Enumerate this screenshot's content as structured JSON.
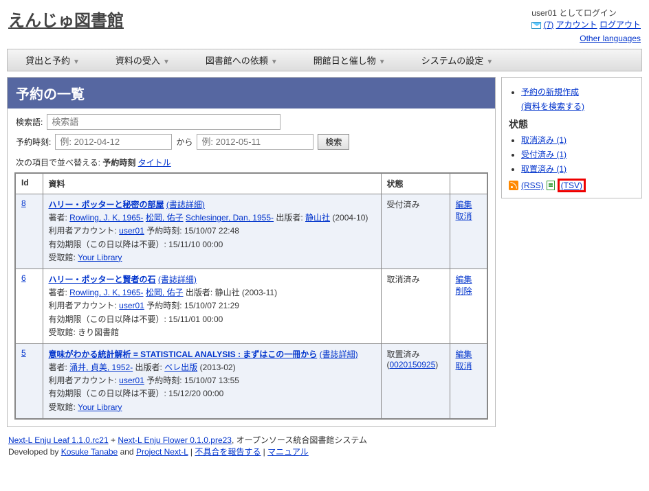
{
  "brand": "えんじゅ図書館",
  "account": {
    "logged_in_as": "user01 としてログイン",
    "messages": "(7)",
    "account_link": "アカウント",
    "logout": "ログアウト",
    "other_langs": "Other languages"
  },
  "nav": {
    "items": [
      "貸出と予約",
      "資料の受入",
      "図書館への依頼",
      "開館日と催し物",
      "システムの設定"
    ]
  },
  "page": {
    "title": "予約の一覧",
    "search_label": "検索語:",
    "search_placeholder": "検索語",
    "period_label": "予約時刻:",
    "from_placeholder": "例: 2012-04-12",
    "to_label": "から",
    "to_placeholder": "例: 2012-05-11",
    "search_btn": "検索",
    "sort_prefix": "次の項目で並べ替える: ",
    "sort_active": "予約時刻",
    "sort_link": "タイトル"
  },
  "table": {
    "headers": {
      "id": "Id",
      "material": "資料",
      "status": "状態",
      "actions": ""
    },
    "rows": [
      {
        "id": "8",
        "title": "ハリー・ポッターと秘密の部屋",
        "detail": "(書誌詳細)",
        "authors_label": "著者: ",
        "authors": [
          "Rowling, J. K, 1965-",
          "松岡, 佑子",
          "Schlesinger, Dan, 1955-"
        ],
        "publisher_label": " 出版者: ",
        "publisher": "静山社",
        "pubdate": " (2004-10)",
        "user_label": "利用者アカウント: ",
        "user": "user01",
        "reserve_label": " 予約時刻: ",
        "reserve_time": "15/10/07 22:48",
        "expire_label": "有効期限（この日以降は不要）: ",
        "expire": "15/11/10 00:00",
        "pickup_label": "受取館: ",
        "pickup": "Your Library",
        "status": "受付済み",
        "actions": [
          "編集",
          "取消"
        ]
      },
      {
        "id": "6",
        "title": "ハリー・ポッターと賢者の石",
        "detail": "(書誌詳細)",
        "authors_label": "著者: ",
        "authors": [
          "Rowling, J. K, 1965-",
          "松岡, 佑子"
        ],
        "publisher_label": " 出版者: ",
        "publisher_plain": "静山社 (2003-11)",
        "user_label": "利用者アカウント: ",
        "user": "user01",
        "reserve_label": " 予約時刻: ",
        "reserve_time": "15/10/07 21:29",
        "expire_label": "有効期限（この日以降は不要）: ",
        "expire": "15/11/01 00:00",
        "pickup_label": "受取館: ",
        "pickup_plain": "きり図書館",
        "status": "取消済み",
        "actions": [
          "編集",
          "削除"
        ]
      },
      {
        "id": "5",
        "title": "意味がわかる統計解析 = STATISTICAL ANALYSIS : まずはこの一冊から",
        "detail": "(書誌詳細)",
        "authors_label": "著者: ",
        "authors": [
          "涌井, 貞美, 1952-"
        ],
        "publisher_label": " 出版者: ",
        "publisher": "ベレ出版",
        "pubdate": " (2013-02)",
        "user_label": "利用者アカウント: ",
        "user": "user01",
        "reserve_label": " 予約時刻: ",
        "reserve_time": "15/10/07 13:55",
        "expire_label": "有効期限（この日以降は不要）: ",
        "expire": "15/12/20 00:00",
        "pickup_label": "受取館: ",
        "pickup": "Your Library",
        "status": "取置済み (",
        "status_link": "0020150925",
        "status_after": ")",
        "actions": [
          "編集",
          "取消"
        ]
      }
    ]
  },
  "sidebar": {
    "new_reserve": "予約の新規作成",
    "search_material": "(資料を検索する)",
    "status_header": "状態",
    "filters": [
      "取消済み (1)",
      "受付済み (1)",
      "取置済み (1)"
    ],
    "rss": "(RSS)",
    "tsv": "(TSV)"
  },
  "footer": {
    "leaf": "Next-L Enju Leaf 1.1.0.rc21",
    "plus": " + ",
    "flower": "Next-L Enju Flower 0.1.0.pre23",
    "desc": ", オープンソース統合図書館システム",
    "dev_by": "Developed by ",
    "kosuke": "Kosuke Tanabe",
    "and": " and ",
    "nextl": "Project Next-L",
    "sep": " | ",
    "bug": "不具合を報告する",
    "manual": "マニュアル"
  }
}
